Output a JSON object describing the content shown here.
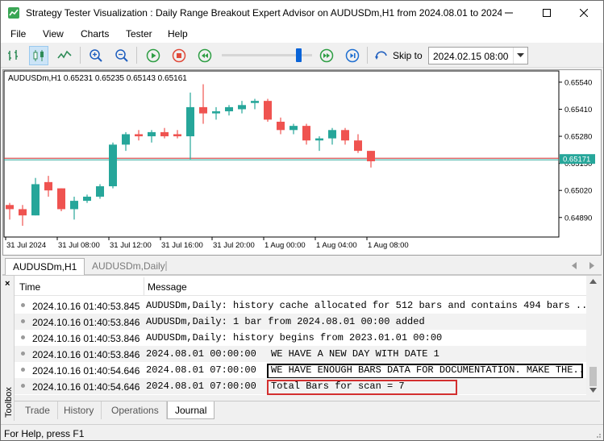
{
  "window": {
    "title": "Strategy Tester Visualization : Daily Range Breakout Expert Advisor on AUDUSDm,H1 from 2024.08.01 to 2024...."
  },
  "menu": [
    "File",
    "View",
    "Charts",
    "Tester",
    "Help"
  ],
  "toolbar": {
    "skip_label": "Skip to",
    "skip_date": "2024.02.15 08:00",
    "speed_level": 0.85
  },
  "chart": {
    "header": "AUDUSDm,H1  0.65231 0.65235 0.65143 0.65161",
    "price_label": "0.65171",
    "colors": {
      "bull": "#26a69a",
      "bear": "#ef5350",
      "price_line": "#d62f2f",
      "price_tag": "#26a69a"
    }
  },
  "chart_data": {
    "type": "candlestick",
    "symbol": "AUDUSDm,H1",
    "ylim": [
      0.648,
      0.6559
    ],
    "y_ticks": [
      "0.65540",
      "0.65410",
      "0.65280",
      "0.65150",
      "0.65020",
      "0.64890"
    ],
    "y_tick_values": [
      0.6554,
      0.6541,
      0.6528,
      0.6515,
      0.6502,
      0.6489
    ],
    "x_tick_labels": [
      "31 Jul 2024",
      "31 Jul 08:00",
      "31 Jul 12:00",
      "31 Jul 16:00",
      "31 Jul 20:00",
      "1 Aug 00:00",
      "1 Aug 04:00",
      "1 Aug 08:00"
    ],
    "x_tick_index": [
      0,
      4,
      8,
      12,
      16,
      20,
      24,
      28
    ],
    "candles": [
      {
        "o": 0.6495,
        "h": 0.6496,
        "l": 0.6488,
        "c": 0.6493
      },
      {
        "o": 0.6493,
        "h": 0.6495,
        "l": 0.6485,
        "c": 0.649
      },
      {
        "o": 0.649,
        "h": 0.6508,
        "l": 0.649,
        "c": 0.6505
      },
      {
        "o": 0.6506,
        "h": 0.6509,
        "l": 0.6499,
        "c": 0.6502
      },
      {
        "o": 0.6503,
        "h": 0.6503,
        "l": 0.6492,
        "c": 0.6493
      },
      {
        "o": 0.6493,
        "h": 0.6499,
        "l": 0.6488,
        "c": 0.6497
      },
      {
        "o": 0.6497,
        "h": 0.65,
        "l": 0.6496,
        "c": 0.6499
      },
      {
        "o": 0.6499,
        "h": 0.6505,
        "l": 0.6498,
        "c": 0.6504
      },
      {
        "o": 0.6504,
        "h": 0.6525,
        "l": 0.6503,
        "c": 0.6524
      },
      {
        "o": 0.6524,
        "h": 0.653,
        "l": 0.6521,
        "c": 0.6529
      },
      {
        "o": 0.6529,
        "h": 0.6531,
        "l": 0.6526,
        "c": 0.6528
      },
      {
        "o": 0.6528,
        "h": 0.6531,
        "l": 0.6525,
        "c": 0.653
      },
      {
        "o": 0.653,
        "h": 0.6532,
        "l": 0.6527,
        "c": 0.6528
      },
      {
        "o": 0.6529,
        "h": 0.6531,
        "l": 0.6527,
        "c": 0.6528
      },
      {
        "o": 0.6528,
        "h": 0.6549,
        "l": 0.6517,
        "c": 0.6542
      },
      {
        "o": 0.6542,
        "h": 0.6553,
        "l": 0.6534,
        "c": 0.6539
      },
      {
        "o": 0.6539,
        "h": 0.6542,
        "l": 0.6536,
        "c": 0.654
      },
      {
        "o": 0.654,
        "h": 0.6543,
        "l": 0.6538,
        "c": 0.6542
      },
      {
        "o": 0.6541,
        "h": 0.6545,
        "l": 0.6539,
        "c": 0.6543
      },
      {
        "o": 0.6544,
        "h": 0.6546,
        "l": 0.6541,
        "c": 0.6545
      },
      {
        "o": 0.6545,
        "h": 0.6546,
        "l": 0.6535,
        "c": 0.6536
      },
      {
        "o": 0.6535,
        "h": 0.6537,
        "l": 0.6529,
        "c": 0.6531
      },
      {
        "o": 0.6531,
        "h": 0.6534,
        "l": 0.6529,
        "c": 0.6533
      },
      {
        "o": 0.6533,
        "h": 0.6534,
        "l": 0.6524,
        "c": 0.6526
      },
      {
        "o": 0.6526,
        "h": 0.6528,
        "l": 0.6521,
        "c": 0.6527
      },
      {
        "o": 0.6527,
        "h": 0.6532,
        "l": 0.6524,
        "c": 0.6531
      },
      {
        "o": 0.6531,
        "h": 0.6532,
        "l": 0.6524,
        "c": 0.6526
      },
      {
        "o": 0.6526,
        "h": 0.6529,
        "l": 0.652,
        "c": 0.6521
      },
      {
        "o": 0.6521,
        "h": 0.6521,
        "l": 0.6513,
        "c": 0.6516
      }
    ],
    "last_price": 0.65171,
    "grid": false
  },
  "chart_tabs": [
    {
      "label": "AUDUSDm,H1",
      "active": true
    },
    {
      "label": "AUDUSDm,Daily",
      "active": false
    }
  ],
  "journal": {
    "columns": [
      "Time",
      "Message"
    ],
    "rows": [
      {
        "time": "2024.10.16 01:40:53.845",
        "message": "AUDUSDm,Daily: history cache allocated for 512 bars and contains 494 bars ...",
        "message2": ""
      },
      {
        "time": "2024.10.16 01:40:53.846",
        "message": "AUDUSDm,Daily: 1 bar from 2024.08.01 00:00 added",
        "message2": ""
      },
      {
        "time": "2024.10.16 01:40:53.846",
        "message": "AUDUSDm,Daily: history begins from 2023.01.01 00:00",
        "message2": ""
      },
      {
        "time": "2024.10.16 01:40:53.846",
        "message": "2024.08.01 00:00:00",
        "message2": "WE HAVE A NEW DAY WITH DATE 1"
      },
      {
        "time": "2024.10.16 01:40:54.646",
        "message": "2024.08.01 07:00:00",
        "message2": "WE HAVE ENOUGH BARS DATA FOR DOCUMENTATION. MAKE THE..."
      },
      {
        "time": "2024.10.16 01:40:54.646",
        "message": "2024.08.01 07:00:00",
        "message2": "Total Bars for scan = 7"
      }
    ]
  },
  "toolbox_label": "Toolbox",
  "bottom_tabs": [
    {
      "label": "Trade",
      "active": false
    },
    {
      "label": "History",
      "active": false
    },
    {
      "label": "Operations",
      "active": false
    },
    {
      "label": "Journal",
      "active": true
    }
  ],
  "status": "For Help, press F1"
}
